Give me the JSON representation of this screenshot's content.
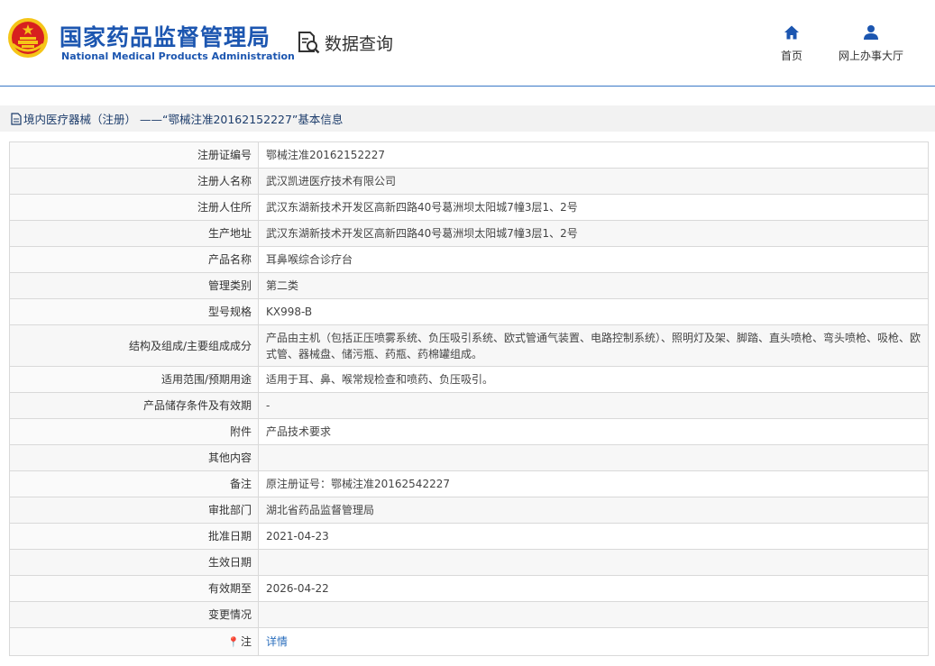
{
  "header": {
    "brand_cn": "国家药品监督管理局",
    "brand_en": "National Medical Products Administration",
    "query_label": "数据查询",
    "nav": [
      {
        "label": "首页",
        "icon": "home-icon"
      },
      {
        "label": "网上办事大厅",
        "icon": "user-icon"
      }
    ]
  },
  "breadcrumb": {
    "text": "境内医疗器械（注册） ——“鄂械注准20162152227”基本信息",
    "icon": "document-icon"
  },
  "colors": {
    "brand_blue": "#1c56b0",
    "header_line": "#3a79c7",
    "link": "#2a6ebd",
    "emblem_red": "#d71f1f",
    "emblem_gold": "#f5c518"
  },
  "detail": {
    "rows": [
      {
        "label": "注册证编号",
        "value": "鄂械注准20162152227"
      },
      {
        "label": "注册人名称",
        "value": "武汉凯进医疗技术有限公司"
      },
      {
        "label": "注册人住所",
        "value": "武汉东湖新技术开发区高新四路40号葛洲坝太阳城7幢3层1、2号"
      },
      {
        "label": "生产地址",
        "value": "武汉东湖新技术开发区高新四路40号葛洲坝太阳城7幢3层1、2号"
      },
      {
        "label": "产品名称",
        "value": "耳鼻喉综合诊疗台"
      },
      {
        "label": "管理类别",
        "value": "第二类"
      },
      {
        "label": "型号规格",
        "value": "KX998-B"
      },
      {
        "label": "结构及组成/主要组成成分",
        "value": "产品由主机（包括正压喷雾系统、负压吸引系统、欧式管通气装置、电路控制系统）、照明灯及架、脚踏、直头喷枪、弯头喷枪、吸枪、欧式管、器械盘、储污瓶、药瓶、药棉罐组成。"
      },
      {
        "label": "适用范围/预期用途",
        "value": "适用于耳、鼻、喉常规检查和喷药、负压吸引。"
      },
      {
        "label": "产品储存条件及有效期",
        "value": "-"
      },
      {
        "label": "附件",
        "value": "产品技术要求"
      },
      {
        "label": "其他内容",
        "value": ""
      },
      {
        "label": "备注",
        "value": "原注册证号：鄂械注准20162542227"
      },
      {
        "label": "审批部门",
        "value": "湖北省药品监督管理局"
      },
      {
        "label": "批准日期",
        "value": "2021-04-23"
      },
      {
        "label": "生效日期",
        "value": ""
      },
      {
        "label": "有效期至",
        "value": "2026-04-22"
      },
      {
        "label": "变更情况",
        "value": ""
      },
      {
        "label": "注",
        "value": "详情",
        "link": true,
        "icon": "pin-icon"
      }
    ]
  }
}
